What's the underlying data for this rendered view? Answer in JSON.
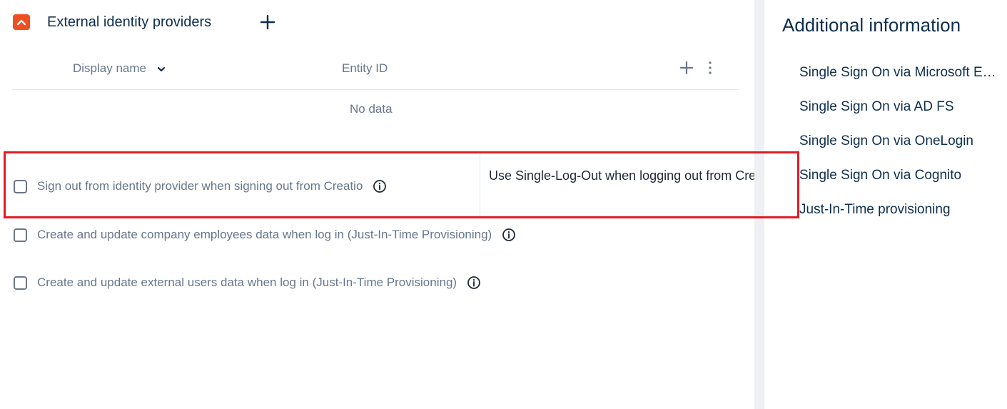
{
  "section": {
    "title": "External identity providers"
  },
  "grid": {
    "columns": [
      "Display name",
      "Entity ID"
    ],
    "empty_text": "No data"
  },
  "options": [
    {
      "label": "Sign out from identity provider when signing out from Creatio",
      "checked": false
    },
    {
      "label": "Create and update company employees data when log in (Just-In-Time Provisioning)",
      "checked": false
    },
    {
      "label": "Create and update external users data when log in (Just-In-Time Provisioning)",
      "checked": false
    }
  ],
  "tooltip": {
    "text": "Use Single-Log-Out when logging out from Creatio"
  },
  "additional_info": {
    "title": "Additional information",
    "links": [
      "Single Sign On via Microsoft Entra ID",
      "Single Sign On via AD FS",
      "Single Sign On via OneLogin",
      "Single Sign On via Cognito",
      "Just-In-Time provisioning"
    ]
  },
  "colors": {
    "accent_orange": "#f04e23",
    "heading_navy": "#0d2e4e",
    "muted_text": "#67768a",
    "highlight_red": "#e31b23"
  },
  "icons": {
    "collapse": "chevron-up-icon",
    "add": "plus-icon",
    "sort": "chevron-down-icon",
    "more": "vertical-dots-icon",
    "info": "info-circle-icon",
    "checkbox": "checkbox-unchecked"
  }
}
